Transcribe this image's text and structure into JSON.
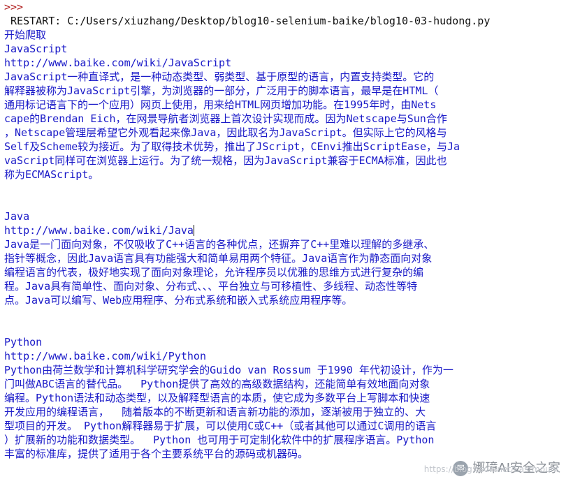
{
  "shell": {
    "prompt": ">>>",
    "restart": " RESTART: C:/Users/xiuzhang/Desktop/blog10-selenium-baike/blog10-03-hudong.py",
    "start_message": "开始爬取",
    "entries": [
      {
        "title": "JavaScript",
        "url": "http://www.baike.com/wiki/JavaScript",
        "lines": [
          "JavaScript一种直译式，是一种动态类型、弱类型、基于原型的语言，内置支持类型。它的",
          "解释器被称为JavaScript引擎，为浏览器的一部分，广泛用于的脚本语言，最早是在HTML（",
          "通用标记语言下的一个应用）网页上使用，用来给HTML网页增加功能。在1995年时，由Nets",
          "cape的Brendan Eich，在网景导航者浏览器上首次设计实现而成。因为Netscape与Sun合作",
          "，Netscape管理层希望它外观看起来像Java，因此取名为JavaScript。但实际上它的风格与",
          "Self及Scheme较为接近。为了取得技术优势，推出了JScript，CEnvi推出ScriptEase，与Ja",
          "vaScript同样可在浏览器上运行。为了统一规格，因为JavaScript兼容于ECMA标准，因此也",
          "称为ECMAScript。"
        ]
      },
      {
        "title": "Java",
        "url": "http://www.baike.com/wiki/Java",
        "lines": [
          "Java是一门面向对象，不仅吸收了C++语言的各种优点，还摒弃了C++里难以理解的多继承、",
          "指针等概念，因此Java语言具有功能强大和简单易用两个特征。Java语言作为静态面向对象",
          "编程语言的代表，极好地实现了面向对象理论，允许程序员以优雅的思维方式进行复杂的编",
          "程。Java具有简单性、面向对象、分布式、、、平台独立与可移植性、多线程、动态性等特",
          "点。Java可以编写、Web应用程序、分布式系统和嵌入式系统应用程序等。"
        ]
      },
      {
        "title": "Python",
        "url": "http://www.baike.com/wiki/Python",
        "lines": [
          "Python由荷兰数学和计算机科学研究学会的Guido van Rossum 于1990 年代初设计，作为一",
          "门叫做ABC语言的替代品。  Python提供了高效的高级数据结构，还能简单有效地面向对象",
          "编程。Python语法和动态类型，以及解释型语言的本质，使它成为多数平台上写脚本和快速",
          "开发应用的编程语言，  随着版本的不断更新和语言新功能的添加，逐渐被用于独立的、大",
          "型项目的开发。 Python解释器易于扩展，可以使用C或C++（或者其他可以通过C调用的语言",
          "）扩展新的功能和数据类型。  Python 也可用于可定制化软件中的扩展程序语言。Python",
          "丰富的标准库，提供了适用于各个主要系统平台的源码或机器码。"
        ]
      }
    ]
  },
  "watermark": {
    "label": "娜璋AI安全之家",
    "url": "https://blog.csdn.net/Eastmount"
  },
  "colors": {
    "output_text": "#1a1ac8",
    "prompt": "#b01e1e",
    "restart": "#111111",
    "background": "#ffffff"
  }
}
